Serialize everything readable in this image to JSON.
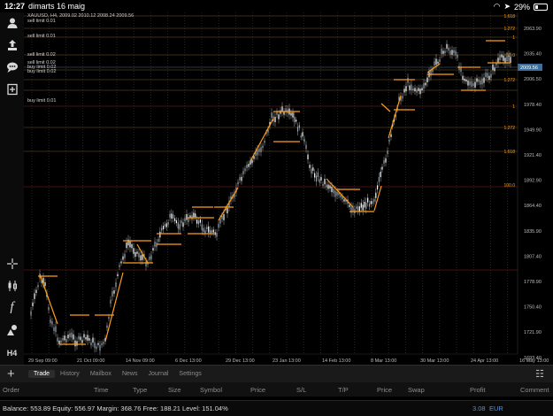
{
  "status": {
    "time": "12:27",
    "date": "dimarts 16 maig",
    "battery": "29%",
    "battery_level": 0.29
  },
  "symbol_info": "XAUUSD, H4, 2009.02 2010.12 2008.24 2009.56",
  "annotations": [
    {
      "text": "sell limit 0.01"
    },
    {
      "text": "sell limit 0.01"
    },
    {
      "text": "sell limit 0.02"
    },
    {
      "text": "sell limit 0.02"
    },
    {
      "text": "buy limit 0.02"
    },
    {
      "text": "buy limit 0.02"
    },
    {
      "text": "buy limit 0.01"
    }
  ],
  "price_axis": [
    "2063.90",
    "2035.40",
    "2006.50",
    "1978.40",
    "1949.90",
    "1921.40",
    "1892.90",
    "1864.40",
    "1835.90",
    "1807.40",
    "1778.90",
    "1750.40",
    "1721.90",
    "1693.40",
    "1664.90",
    "1636.40"
  ],
  "fib_labels": [
    "1.618",
    "1.272",
    "1",
    "50.0",
    "1.272",
    "1",
    "1.272",
    "1.618",
    "100.0"
  ],
  "current_price": "2009.56",
  "time_axis": [
    "29 Sep 09:00",
    "21 Oct 09:00",
    "14 Nov 09:00",
    "6 Dec 13:00",
    "29 Dec 13:00",
    "23 Jan 13:00",
    "14 Feb 13:00",
    "8 Mar 13:00",
    "30 Mar 13:00",
    "24 Apr 13:00",
    "16 May 13:00"
  ],
  "left_tools": [
    {
      "name": "account-icon"
    },
    {
      "name": "trade-icon"
    },
    {
      "name": "chat-icon"
    },
    {
      "name": "add-chart-icon"
    },
    {
      "name": "crosshair-icon"
    },
    {
      "name": "chart-type-icon"
    },
    {
      "name": "indicator-icon"
    },
    {
      "name": "objects-icon"
    }
  ],
  "timeframe": "H4",
  "tabs": [
    "Trade",
    "History",
    "Mailbox",
    "News",
    "Journal",
    "Settings"
  ],
  "active_tab": "Trade",
  "columns": [
    "Order",
    "Time",
    "Type",
    "Size",
    "Symbol",
    "Price",
    "S/L",
    "T/P",
    "Price",
    "Swap",
    "Profit",
    "Comment"
  ],
  "balance_line": "Balance: 553.89 Equity: 556.97 Margin: 368.76 Free: 188.21 Level: 151.04%",
  "profit": "3.08",
  "currency": "EUR",
  "colors": {
    "accent": "#ff9d1a",
    "profit": "#4f8fe8",
    "level_red": "#8a1f1f",
    "level_blue": "#3f6e9a"
  }
}
